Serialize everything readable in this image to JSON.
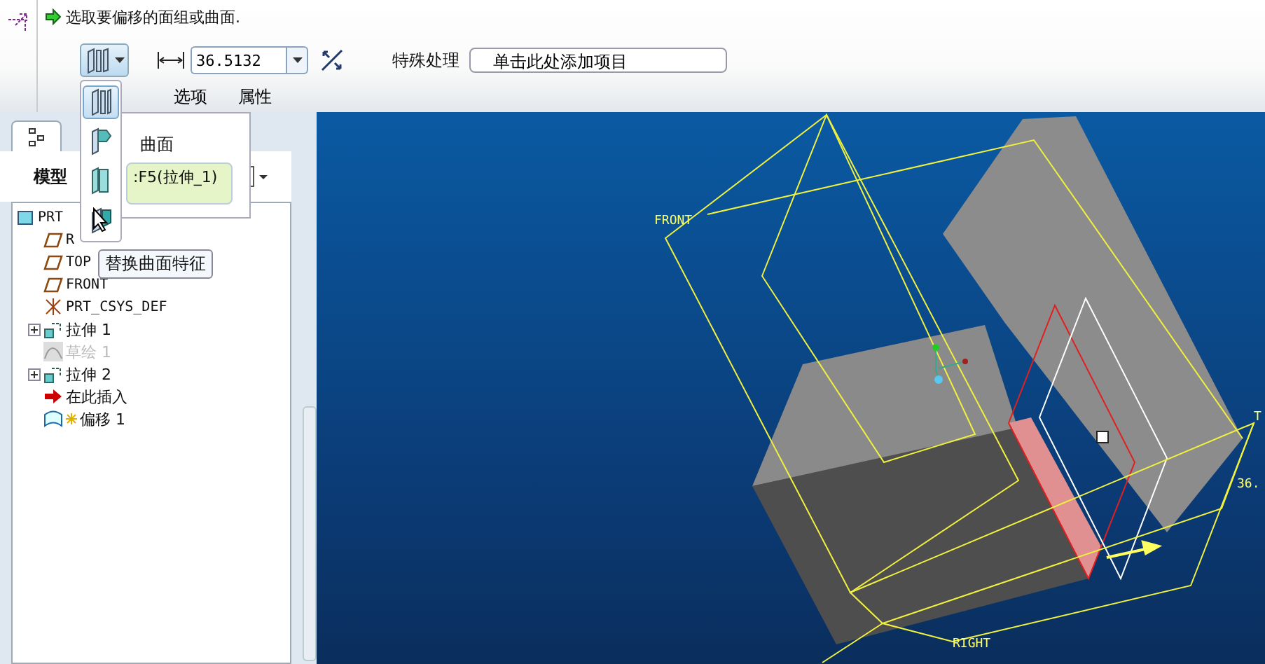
{
  "prompt": {
    "text": "选取要偏移的面组或曲面."
  },
  "toolbar": {
    "distance": "36.5132",
    "special_label": "特殊处理",
    "special_field": "单击此处添加项目"
  },
  "tabs": [
    {
      "label": "选项"
    },
    {
      "label": "属性"
    }
  ],
  "type_menu": {
    "items": [
      {
        "kind": "standard",
        "selected": true
      },
      {
        "kind": "expand",
        "selected": false
      },
      {
        "kind": "draft",
        "selected": false
      },
      {
        "kind": "replace",
        "selected": false
      }
    ],
    "tooltip": "替换曲面特征"
  },
  "references_panel": {
    "label": "曲面",
    "field": ":F5(拉伸_1)"
  },
  "model_tree": {
    "title": "模型",
    "items": [
      {
        "label": "PRT",
        "kind": "part",
        "children": [
          {
            "label": "R",
            "kind": "plane",
            "expandable": false,
            "disabled": false,
            "new": false
          },
          {
            "label": "TOP",
            "kind": "plane",
            "expandable": false,
            "disabled": false,
            "new": false
          },
          {
            "label": "FRONT",
            "kind": "plane",
            "expandable": false,
            "disabled": false,
            "new": false
          },
          {
            "label": "PRT_CSYS_DEF",
            "kind": "csys",
            "expandable": false,
            "disabled": false,
            "new": false
          },
          {
            "label": "拉伸 1",
            "kind": "extrude",
            "expandable": true,
            "disabled": false,
            "new": false
          },
          {
            "label": "草绘 1",
            "kind": "sketch",
            "expandable": false,
            "disabled": true,
            "new": false
          },
          {
            "label": "拉伸 2",
            "kind": "extrude",
            "expandable": true,
            "disabled": false,
            "new": false
          },
          {
            "label": "在此插入",
            "kind": "insert",
            "expandable": false,
            "disabled": false,
            "new": false
          },
          {
            "label": "偏移 1",
            "kind": "offset",
            "expandable": false,
            "disabled": false,
            "new": true
          }
        ]
      }
    ]
  },
  "viewport": {
    "labels": [
      {
        "kind": "front",
        "text": "FRONT"
      },
      {
        "kind": "right",
        "text": "RIGHT"
      },
      {
        "kind": "top",
        "text": "T"
      },
      {
        "kind": "dim",
        "text": "36."
      }
    ]
  }
}
